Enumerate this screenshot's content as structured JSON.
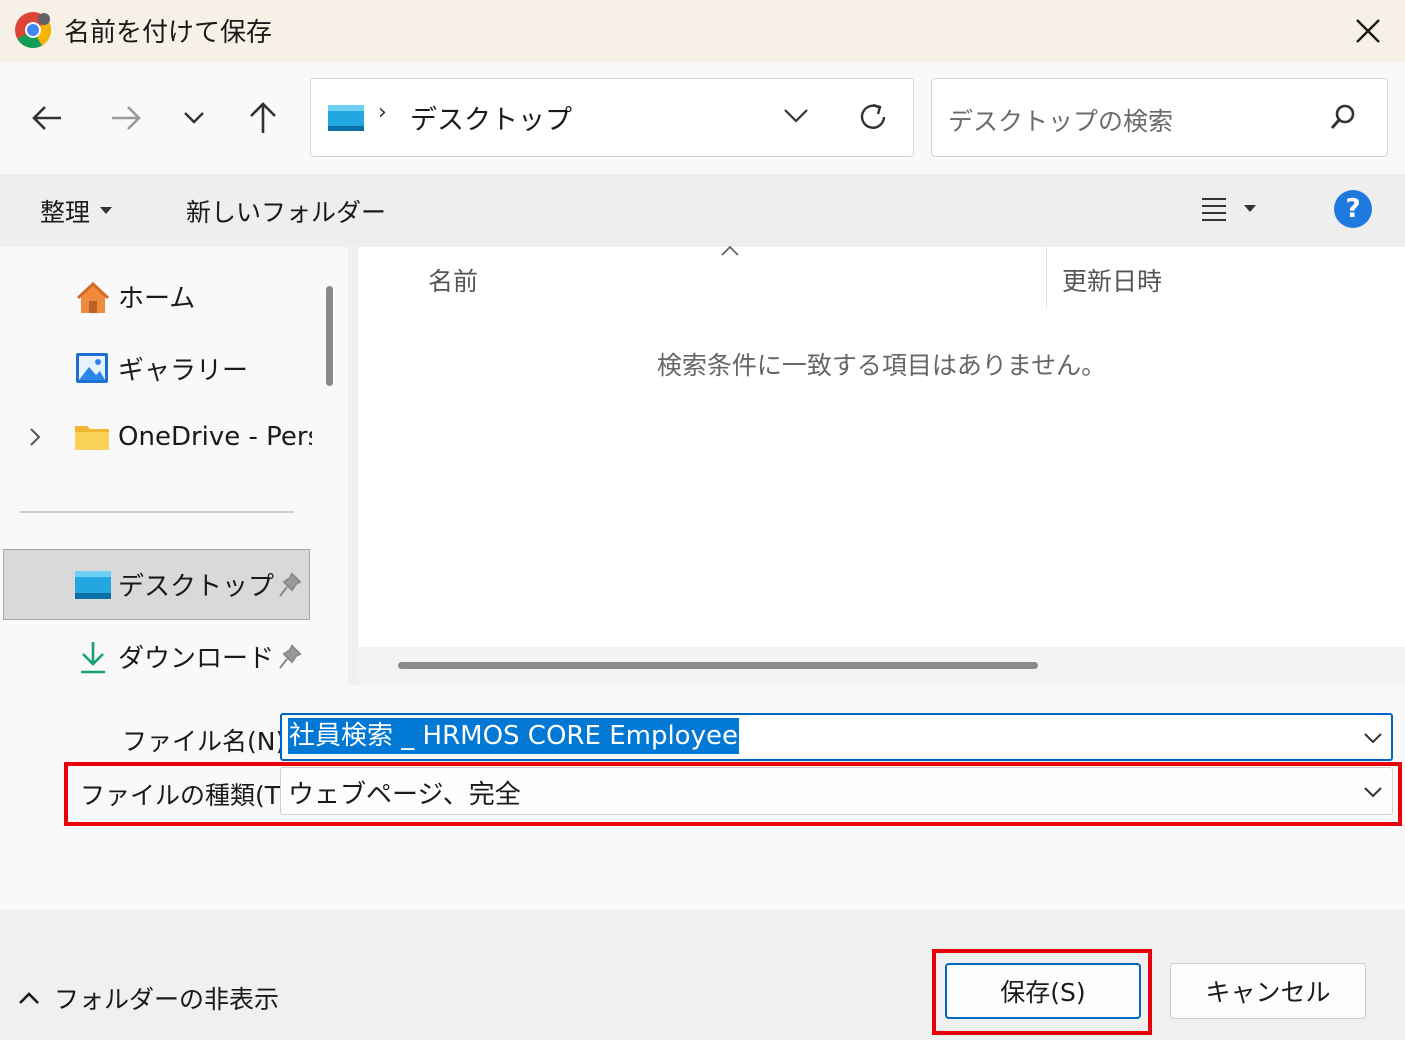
{
  "window": {
    "title": "名前を付けて保存",
    "app_icon": "chrome-icon"
  },
  "address_bar": {
    "separator": "›",
    "location": "デスクトップ"
  },
  "search": {
    "placeholder": "デスクトップの検索"
  },
  "command_bar": {
    "organize_label": "整理",
    "new_folder_label": "新しいフォルダー"
  },
  "nav_pane": {
    "items": [
      {
        "label": "ホーム",
        "icon": "home-icon"
      },
      {
        "label": "ギャラリー",
        "icon": "gallery-icon"
      },
      {
        "label": "OneDrive - Perso",
        "icon": "folder-icon"
      },
      {
        "label": "デスクトップ",
        "icon": "desktop-folder-icon",
        "selected": true,
        "pinned": true
      },
      {
        "label": "ダウンロード",
        "icon": "download-icon",
        "pinned": true
      }
    ]
  },
  "file_list": {
    "columns": [
      "名前",
      "更新日時"
    ],
    "empty_message": "検索条件に一致する項目はありません。"
  },
  "form": {
    "filename_label": "ファイル名(N):",
    "filename_value": "社員検索 _ HRMOS CORE Employee",
    "filetype_label": "ファイルの種類(T):",
    "filetype_value": "ウェブページ、完全"
  },
  "footer": {
    "hide_folders_label": "フォルダーの非表示",
    "save_label": "保存(S)",
    "cancel_label": "キャンセル"
  },
  "colors": {
    "accent": "#0067c0",
    "highlight_box": "#e8000b",
    "help": "#1f7ae0"
  }
}
